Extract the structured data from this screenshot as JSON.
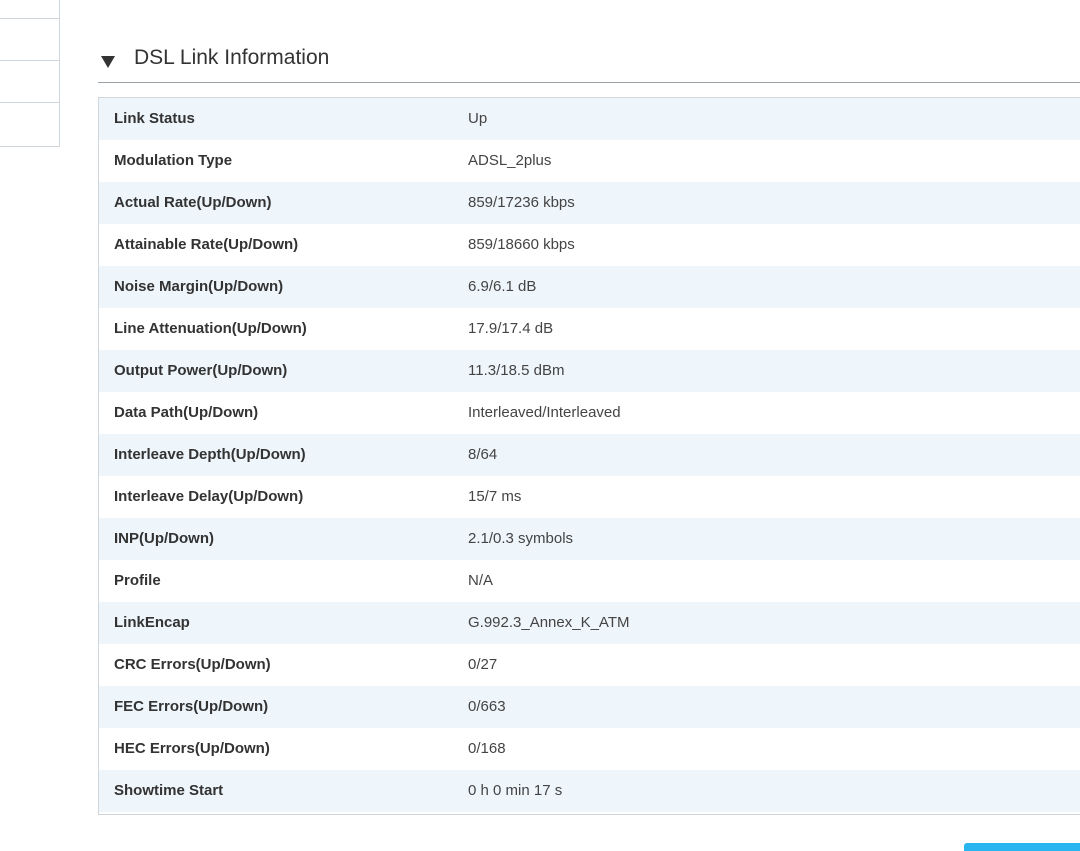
{
  "section": {
    "title": "DSL Link Information"
  },
  "rows": [
    {
      "label": "Link Status",
      "value": "Up"
    },
    {
      "label": "Modulation Type",
      "value": "ADSL_2plus"
    },
    {
      "label": "Actual Rate(Up/Down)",
      "value": "859/17236 kbps"
    },
    {
      "label": "Attainable Rate(Up/Down)",
      "value": "859/18660 kbps"
    },
    {
      "label": "Noise Margin(Up/Down)",
      "value": "6.9/6.1 dB"
    },
    {
      "label": "Line Attenuation(Up/Down)",
      "value": "17.9/17.4 dB"
    },
    {
      "label": "Output Power(Up/Down)",
      "value": "11.3/18.5 dBm"
    },
    {
      "label": "Data Path(Up/Down)",
      "value": "Interleaved/Interleaved"
    },
    {
      "label": "Interleave Depth(Up/Down)",
      "value": "8/64"
    },
    {
      "label": "Interleave Delay(Up/Down)",
      "value": "15/7 ms"
    },
    {
      "label": "INP(Up/Down)",
      "value": "2.1/0.3 symbols"
    },
    {
      "label": "Profile",
      "value": "N/A"
    },
    {
      "label": "LinkEncap",
      "value": "G.992.3_Annex_K_ATM"
    },
    {
      "label": "CRC Errors(Up/Down)",
      "value": "0/27"
    },
    {
      "label": "FEC Errors(Up/Down)",
      "value": "0/663"
    },
    {
      "label": "HEC Errors(Up/Down)",
      "value": "0/168"
    },
    {
      "label": "Showtime Start",
      "value": "0 h 0 min 17 s"
    }
  ],
  "colors": {
    "row_stripe": "#eef5fb",
    "accent_button": "#29b6f0",
    "border": "#cfd6dc"
  }
}
